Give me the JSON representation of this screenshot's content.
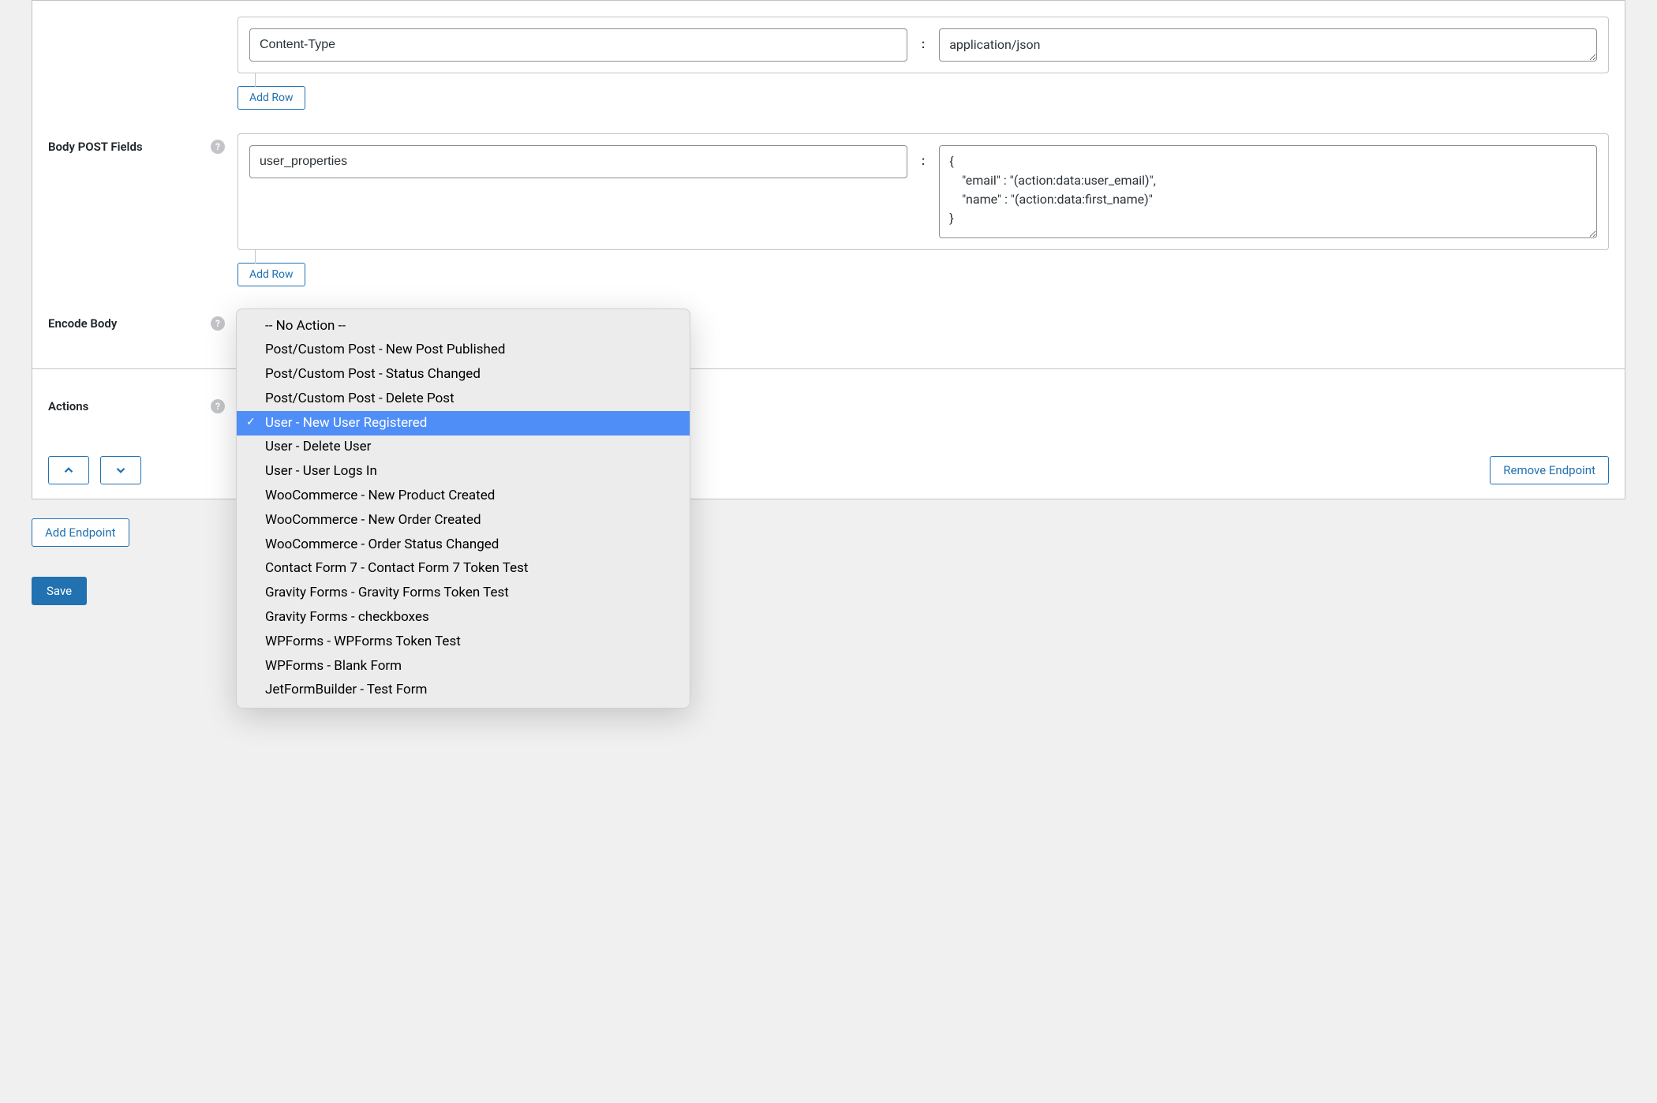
{
  "headers": {
    "key": "Content-Type",
    "value": "application/json",
    "addRowLabel": "Add Row"
  },
  "bodyFields": {
    "label": "Body POST Fields",
    "key": "user_properties",
    "value": "{\n    \"email\" : \"(action:data:user_email)\",\n    \"name\" : \"(action:data:first_name)\"\n}",
    "addRowLabel": "Add Row"
  },
  "encodeBody": {
    "label": "Encode Body"
  },
  "actions": {
    "label": "Actions"
  },
  "dropdown": {
    "items": [
      "-- No Action --",
      "Post/Custom Post - New Post Published",
      "Post/Custom Post - Status Changed",
      "Post/Custom Post - Delete Post",
      "User - New User Registered",
      "User - Delete User",
      "User - User Logs In",
      "WooCommerce - New Product Created",
      "WooCommerce - New Order Created",
      "WooCommerce - Order Status Changed",
      "Contact Form 7 - Contact Form 7 Token Test",
      "Gravity Forms - Gravity Forms Token Test",
      "Gravity Forms - checkboxes",
      "WPForms - WPForms Token Test",
      "WPForms - Blank Form",
      "JetFormBuilder - Test Form"
    ],
    "selectedIndex": 4
  },
  "buttons": {
    "removeEndpoint": "Remove Endpoint",
    "addEndpoint": "Add Endpoint",
    "save": "Save"
  },
  "sep": ":"
}
